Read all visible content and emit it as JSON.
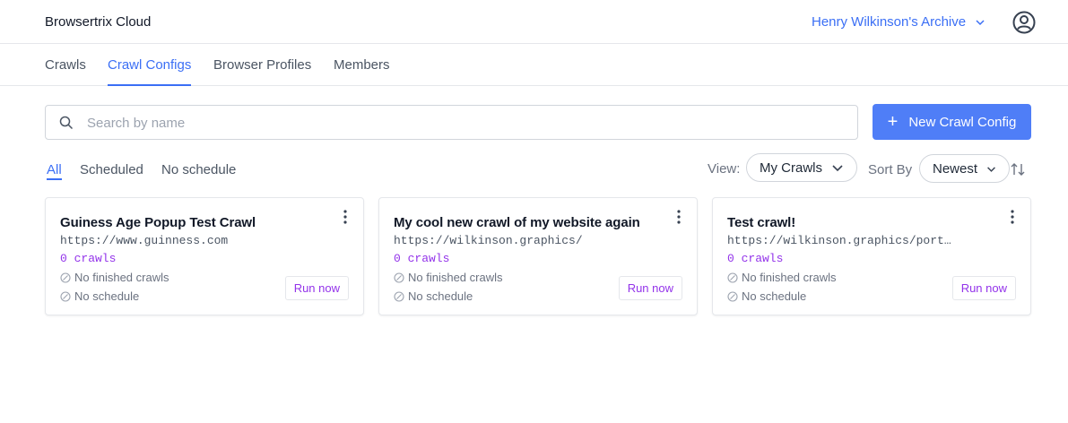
{
  "header": {
    "brand": "Browsertrix Cloud",
    "archive_name": "Henry Wilkinson's Archive",
    "account_icon": "account-icon"
  },
  "tabs": [
    {
      "label": "Crawls",
      "active": false
    },
    {
      "label": "Crawl Configs",
      "active": true
    },
    {
      "label": "Browser Profiles",
      "active": false
    },
    {
      "label": "Members",
      "active": false
    }
  ],
  "search": {
    "placeholder": "Search by name",
    "value": "",
    "icon": "search-icon"
  },
  "new_button": {
    "label": "New Crawl Config",
    "icon": "plus-icon"
  },
  "filters": [
    {
      "label": "All",
      "active": true
    },
    {
      "label": "Scheduled",
      "active": false
    },
    {
      "label": "No schedule",
      "active": false
    }
  ],
  "view": {
    "label": "View:",
    "selected": "My Crawls"
  },
  "sort": {
    "label": "Sort By",
    "selected": "Newest"
  },
  "cards": [
    {
      "title": "Guiness Age Popup Test Crawl",
      "url": "https://www.guinness.com",
      "count": "0 crawls",
      "finished": "No finished crawls",
      "schedule": "No schedule",
      "run_label": "Run now"
    },
    {
      "title": "My cool new crawl of my website again",
      "url": "https://wilkinson.graphics/",
      "count": "0 crawls",
      "finished": "No finished crawls",
      "schedule": "No schedule",
      "run_label": "Run now"
    },
    {
      "title": "Test crawl!",
      "url": "https://wilkinson.graphics/portfolio",
      "count": "0 crawls",
      "finished": "No finished crawls",
      "schedule": "No schedule",
      "run_label": "Run now"
    }
  ],
  "colors": {
    "accent": "#3b6ff5",
    "primary_button": "#4f7ef7",
    "purple": "#9333ea"
  }
}
